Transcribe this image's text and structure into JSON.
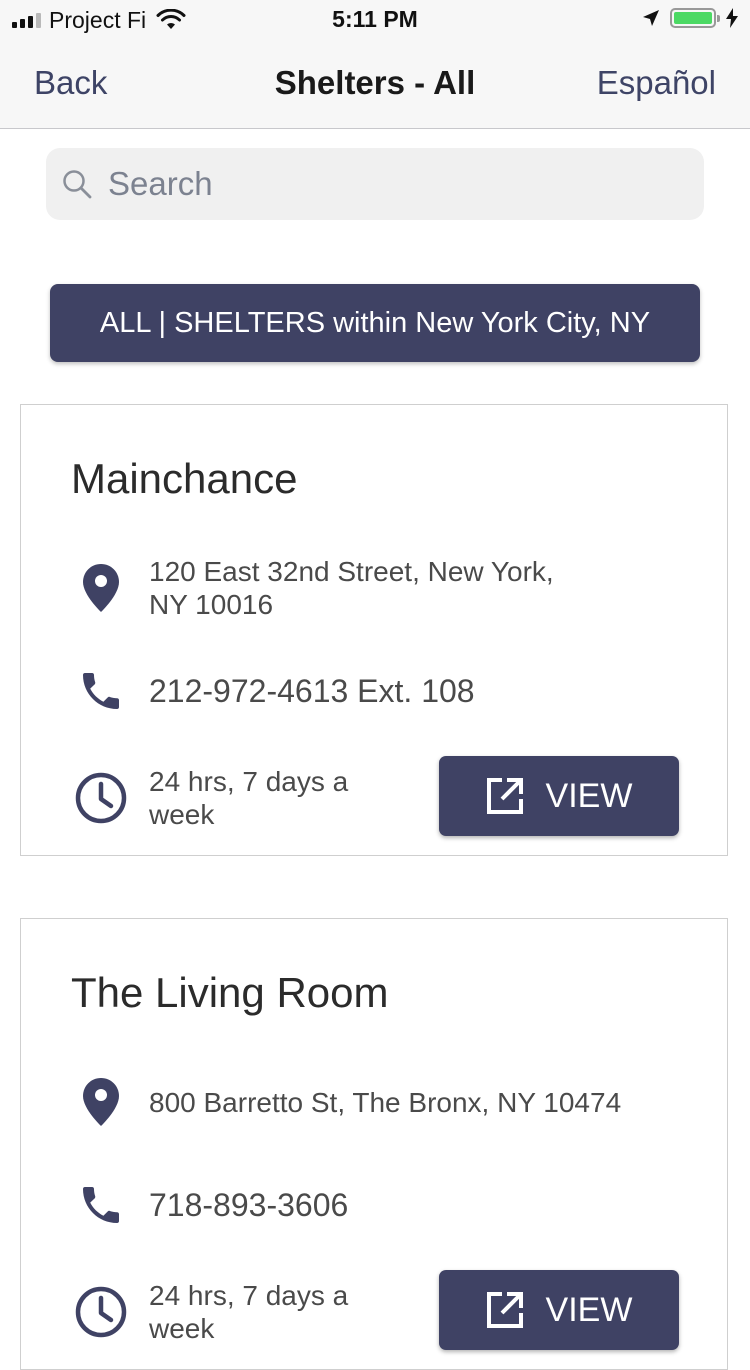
{
  "status_bar": {
    "carrier": "Project Fi",
    "time": "5:11 PM",
    "battery_level": 1.0
  },
  "nav": {
    "back_label": "Back",
    "title": "Shelters - All",
    "language_label": "Español"
  },
  "search": {
    "placeholder": "Search"
  },
  "filter_banner": "ALL | SHELTERS within New York City, NY",
  "shelters": [
    {
      "name": "Mainchance",
      "address": "120 East 32nd Street, New York, NY 10016",
      "phone": "212-972-4613 Ext. 108",
      "hours": "24 hrs, 7 days a week",
      "view_label": "VIEW"
    },
    {
      "name": "The Living Room",
      "address": "800 Barretto St, The Bronx, NY 10474",
      "phone": "718-893-3606",
      "hours": "24 hrs, 7 days a week",
      "view_label": "VIEW"
    }
  ],
  "icons": {
    "address": "location-pin-icon",
    "phone": "phone-icon",
    "hours": "clock-icon",
    "view": "open-external-icon"
  },
  "colors": {
    "accent": "#3f4264",
    "nav_link": "#3e4466",
    "battery": "#4cd964"
  }
}
